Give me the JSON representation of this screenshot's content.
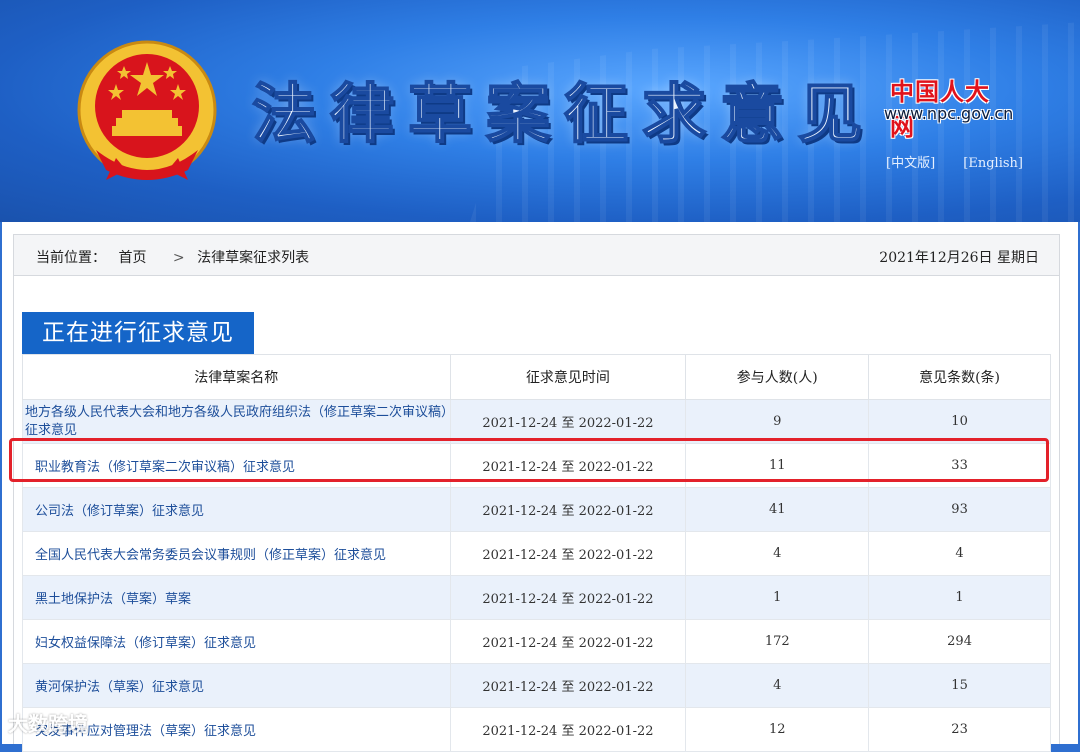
{
  "banner": {
    "title": "法律草案征求意见",
    "site_name_cn": "中国人大网",
    "site_url": "www.npc.gov.cn",
    "lang_cn": "[中文版]",
    "lang_en": "[English]"
  },
  "breadcrumb": {
    "label": "当前位置：",
    "home": "首页",
    "separator": ">",
    "current": "法律草案征求列表",
    "date": "2021年12月26日  星期日"
  },
  "section": {
    "title": "正在进行征求意见"
  },
  "table": {
    "headers": [
      "法律草案名称",
      "征求意见时间",
      "参与人数(人)",
      "意见条数(条)"
    ],
    "rows": [
      {
        "name": "地方各级人民代表大会和地方各级人民政府组织法（修正草案二次审议稿）征求意见",
        "period": "2021-12-24 至 2022-01-22",
        "participants": "9",
        "opinions": "10"
      },
      {
        "name": "职业教育法（修订草案二次审议稿）征求意见",
        "period": "2021-12-24 至 2022-01-22",
        "participants": "11",
        "opinions": "33"
      },
      {
        "name": "公司法（修订草案）征求意见",
        "period": "2021-12-24 至 2022-01-22",
        "participants": "41",
        "opinions": "93"
      },
      {
        "name": "全国人民代表大会常务委员会议事规则（修正草案）征求意见",
        "period": "2021-12-24 至 2022-01-22",
        "participants": "4",
        "opinions": "4"
      },
      {
        "name": "黑土地保护法（草案）草案",
        "period": "2021-12-24 至 2022-01-22",
        "participants": "1",
        "opinions": "1"
      },
      {
        "name": "妇女权益保障法（修订草案）征求意见",
        "period": "2021-12-24 至 2022-01-22",
        "participants": "172",
        "opinions": "294"
      },
      {
        "name": "黄河保护法（草案）征求意见",
        "period": "2021-12-24 至 2022-01-22",
        "participants": "4",
        "opinions": "15"
      },
      {
        "name": "突发事件应对管理法（草案）征求意见",
        "period": "2021-12-24 至 2022-01-22",
        "participants": "12",
        "opinions": "23"
      }
    ]
  },
  "watermark": {
    "text": "大数跨境"
  },
  "colors": {
    "accent": "#1565c8",
    "highlight": "#e3212a"
  }
}
